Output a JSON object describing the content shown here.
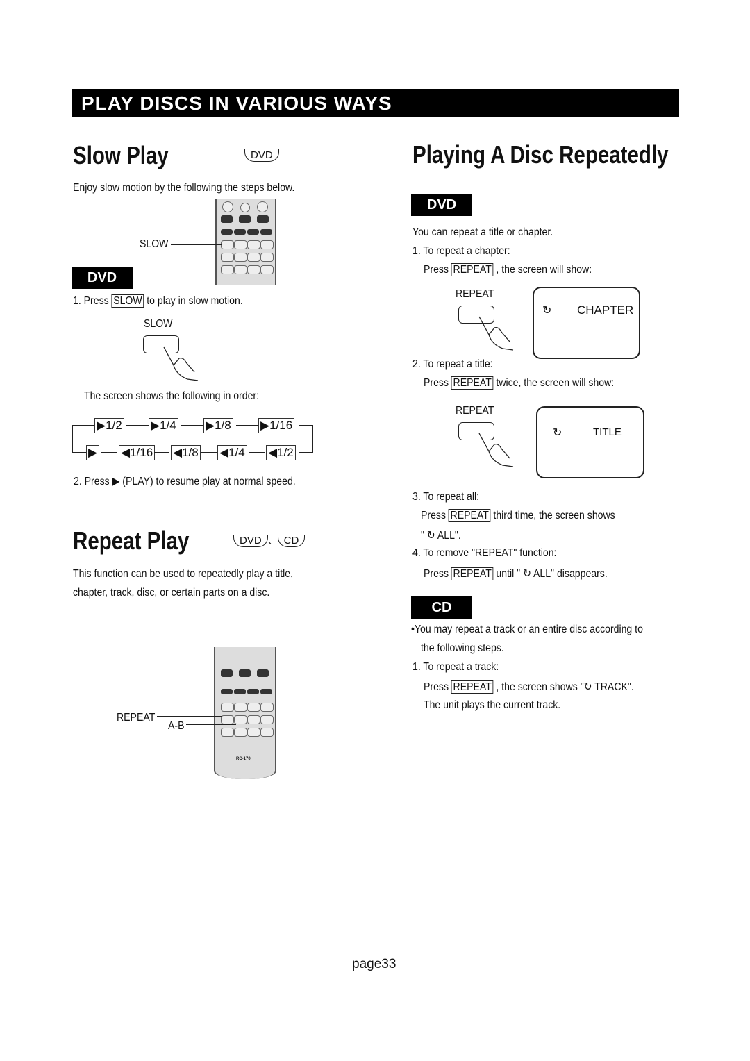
{
  "banner": "PLAY DISCS IN VARIOUS WAYS",
  "slow": {
    "title": "Slow Play",
    "disc_badge": "DVD",
    "intro": "Enjoy  slow  motion by  the  following the steps below.",
    "remote_label": "SLOW",
    "section_badge": "DVD",
    "step1_pre": "1. Press",
    "step1_key": "SLOW",
    "step1_post": "to play in slow motion.",
    "button_label": "SLOW",
    "order_text": "The screen shows the following in order:",
    "forward": [
      "▶1/2",
      "▶1/4",
      "▶1/8",
      "▶1/16"
    ],
    "reverse": [
      "▶",
      "◀1/16",
      "◀1/8",
      "◀1/4",
      "◀1/2"
    ],
    "step2": "2. Press ▶ (PLAY) to resume play at normal speed."
  },
  "repeat_play": {
    "title": "Repeat Play",
    "disc1": "DVD",
    "sep": "、",
    "disc2": "CD",
    "desc1": "This function can be used to  repeatedly play a title,",
    "desc2": "chapter, track, disc, or certain parts on a disc.",
    "label_repeat": "REPEAT",
    "label_ab": "A-B",
    "model": "RC-170"
  },
  "repeatedly": {
    "title": "Playing A Disc Repeatedly",
    "dvd_badge": "DVD",
    "intro": "You can repeat a title or chapter.",
    "s1": "1.  To repeat a chapter:",
    "press": "Press",
    "key": "REPEAT",
    "s1b": ", the screen will show:",
    "btn_label": "REPEAT",
    "screen1": "CHAPTER",
    "s2": "2. To repeat a title:",
    "s2b": "twice,  the screen will show:",
    "screen2": "TITLE",
    "s3": "3. To repeat all:",
    "s3b": "third time, the screen shows",
    "s3c_pre": "\"",
    "s3c_post": "ALL\".",
    "s4": "4. To remove \"REPEAT\" function:",
    "s4b": "until \"",
    "s4c": "ALL\" disappears.",
    "cd_badge": "CD",
    "cd1": "You may repeat a track or an entire disc according to",
    "cd2": "the following steps.",
    "cd3": "1. To repeat a track:",
    "cd4": ", the screen shows \"",
    "cd4b": "TRACK\".",
    "cd5": "The unit plays the current track."
  },
  "footer": "page33"
}
